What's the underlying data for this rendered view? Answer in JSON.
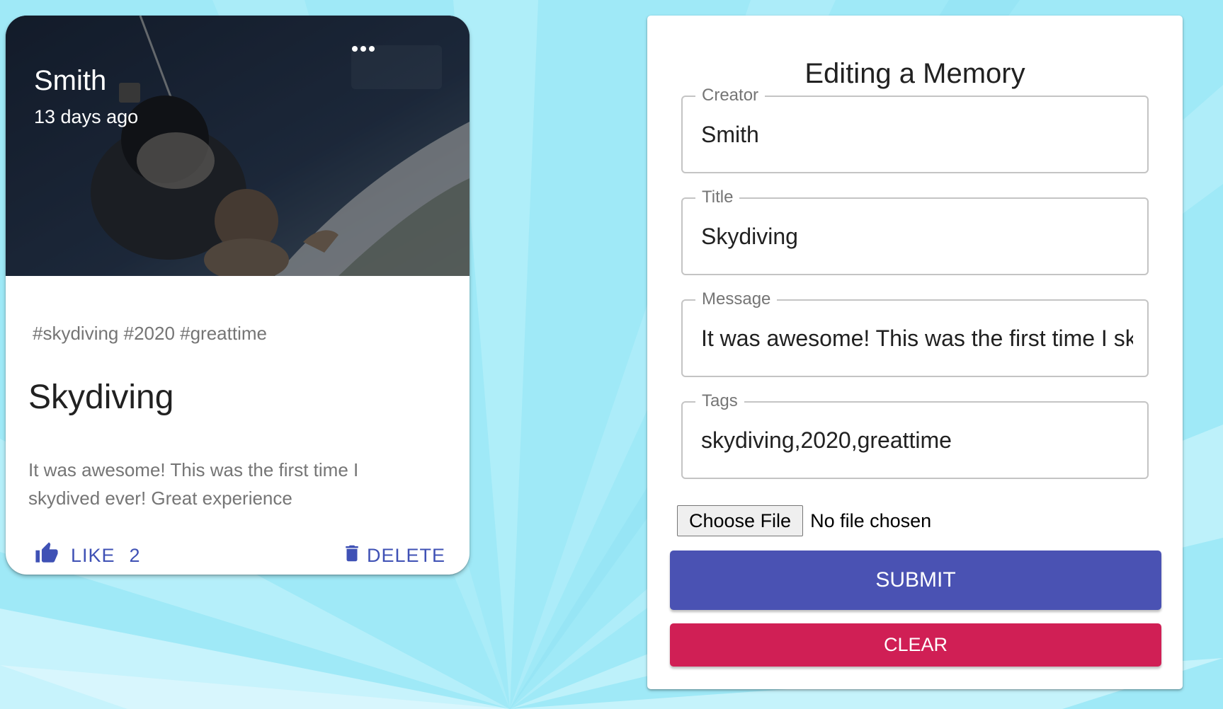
{
  "colors": {
    "background": "#9fe9f7",
    "primary": "#3f51b5",
    "submit": "#4a52b3",
    "clear": "#d01f55",
    "muted_text": "#757575"
  },
  "memory_card": {
    "creator": "Smith",
    "time_ago": "13 days ago",
    "more_icon": "more-horizontal-icon",
    "tags": "#skydiving #2020 #greattime",
    "title": "Skydiving",
    "message": "It was awesome! This was the first time I skydived ever! Great experience",
    "like_icon": "thumb-up-icon",
    "like_label": "LIKE",
    "like_count": "2",
    "delete_icon": "trash-icon",
    "delete_label": "DELETE"
  },
  "form": {
    "heading": "Editing a Memory",
    "fields": [
      {
        "label": "Creator",
        "value": "Smith"
      },
      {
        "label": "Title",
        "value": "Skydiving"
      },
      {
        "label": "Message",
        "value": "It was awesome! This was the first time I skydived ever! Great experience"
      },
      {
        "label": "Tags",
        "value": "skydiving,2020,greattime"
      }
    ],
    "file_button_label": "Choose File",
    "file_status": "No file chosen",
    "submit_label": "SUBMIT",
    "clear_label": "CLEAR"
  }
}
